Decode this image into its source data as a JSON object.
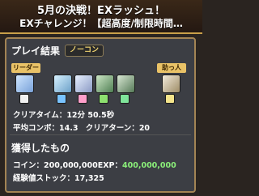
{
  "header": {
    "title_line1": "5月の決戦！EXラッシュ！",
    "title_line2": "EXチャレンジ！【超高度/制限時間…"
  },
  "play_result": {
    "heading": "プレイ結果",
    "badge": "ノーコン",
    "leader_tag": "リーダー",
    "friend_tag": "助っ人",
    "clear_time_label": "クリアタイム：",
    "clear_time_value": "12分 50.5秒",
    "avg_combo_label": "平均コンボ：",
    "avg_combo_value": "14.3",
    "clear_turn_label": "クリアターン：",
    "clear_turn_value": "20"
  },
  "rewards": {
    "heading": "獲得したもの",
    "coin_label": "コイン：",
    "coin_value": "200,000,000",
    "exp_label": "EXP：",
    "exp_value": "400,000,000",
    "stock_label": "経験値ストック：",
    "stock_value": "17,325"
  },
  "colors": {
    "accent_gold": "#c9a049",
    "tag_bg": "#e9c267",
    "exp_green": "#8bf07a",
    "panel_bg": "#3c3e44"
  },
  "team": {
    "monster_icons": [
      "leader-monster-icon",
      "sub-monster-icon-1",
      "sub-monster-icon-2",
      "sub-monster-icon-3",
      "sub-monster-icon-4",
      "friend-monster-icon"
    ],
    "assist_icons": [
      "assist-icon-1",
      "assist-icon-2",
      "assist-icon-3",
      "assist-icon-4",
      "assist-icon-5",
      "assist-icon-6"
    ]
  }
}
